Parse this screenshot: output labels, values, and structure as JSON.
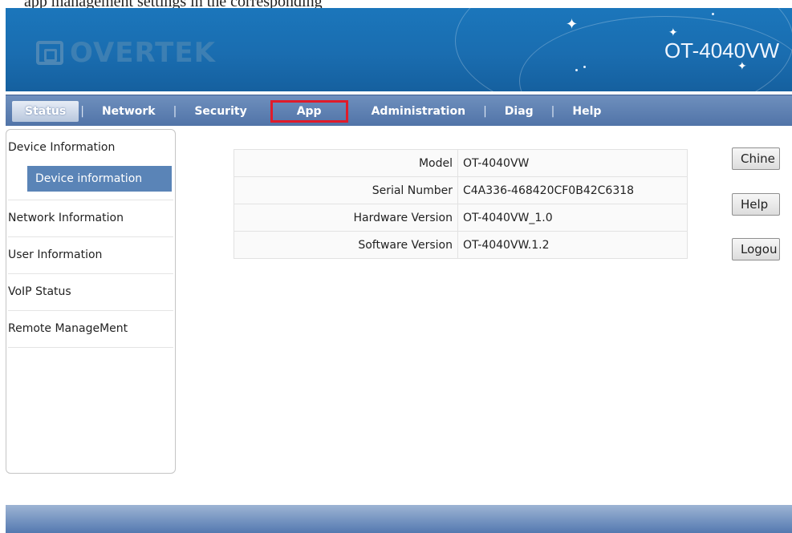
{
  "top_fragment": "app management settings in the corresponding",
  "header": {
    "logo_text": "OVERTEK",
    "model_title": "OT-4040VW"
  },
  "nav": {
    "items": [
      {
        "label": "Status",
        "active": true
      },
      {
        "label": "Network"
      },
      {
        "label": "Security"
      },
      {
        "label": "App",
        "highlighted": true
      },
      {
        "label": "Administration"
      },
      {
        "label": "Diag"
      },
      {
        "label": "Help"
      }
    ],
    "separator": "|"
  },
  "sidebar": {
    "group": {
      "label": "Device Information",
      "sub": "Device information"
    },
    "items": [
      "Network Information",
      "User Information",
      "VoIP Status",
      "Remote ManageMent"
    ]
  },
  "device_info": {
    "rows": [
      {
        "label": "Model",
        "value": "OT-4040VW"
      },
      {
        "label": "Serial Number",
        "value": "C4A336-468420CF0B42C6318"
      },
      {
        "label": "Hardware Version",
        "value": "OT-4040VW_1.0"
      },
      {
        "label": "Software Version",
        "value": "OT-4040VW.1.2"
      }
    ]
  },
  "side_buttons": {
    "chinese": "Chine",
    "help": "Help",
    "logout": "Logou"
  },
  "colors": {
    "header_blue": "#1a6db0",
    "nav_blue": "#5174a8",
    "highlight_red": "#e01b2a",
    "selected_sub": "#5a84b7"
  }
}
